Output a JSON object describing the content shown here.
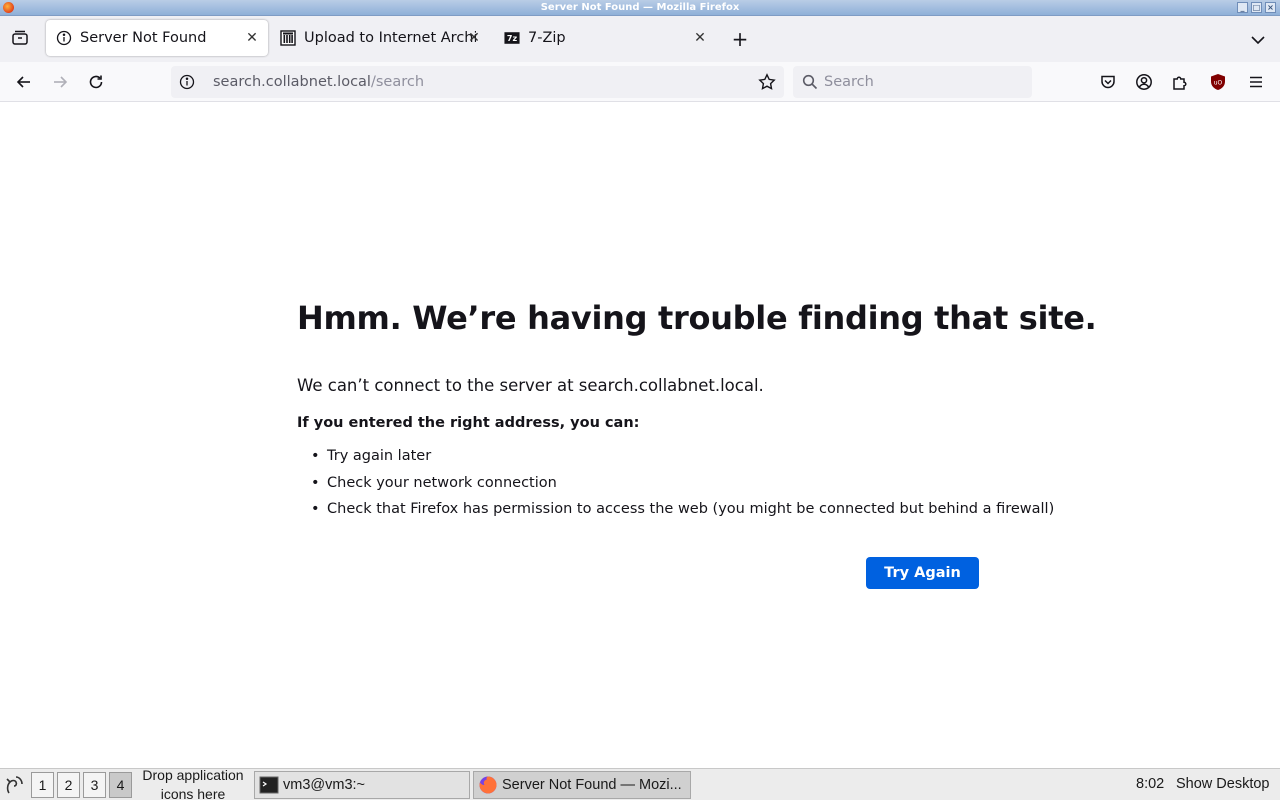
{
  "window": {
    "title": "Server Not Found — Mozilla Firefox",
    "controls": [
      "minimize",
      "maximize",
      "close"
    ]
  },
  "tabs": [
    {
      "label": "Server Not Found",
      "icon": "info-icon",
      "active": true
    },
    {
      "label": "Upload to Internet Archive",
      "icon": "archive-icon",
      "active": false
    },
    {
      "label": "7-Zip",
      "icon": "7zip-icon",
      "active": false
    }
  ],
  "navbar": {
    "url_host": "search.collabnet.local",
    "url_path": "/search",
    "search_placeholder": "Search"
  },
  "error_page": {
    "title": "Hmm. We’re having trouble finding that site.",
    "description": "We can’t connect to the server at search.collabnet.local.",
    "subheading": "If you entered the right address, you can:",
    "suggestions": [
      "Try again later",
      "Check your network connection",
      "Check that Firefox has permission to access the web (you might be connected but behind a firewall)"
    ],
    "button_label": "Try Again",
    "button_color": "#0061e0"
  },
  "taskbar": {
    "workspaces": [
      "1",
      "2",
      "3",
      "4"
    ],
    "active_workspace": "4",
    "drop_hint": "Drop application icons here",
    "tasks": [
      {
        "label": "vm3@vm3:~",
        "icon": "terminal-icon"
      },
      {
        "label": "Server Not Found — Mozi...",
        "icon": "firefox-icon"
      }
    ],
    "clock": "8:02",
    "show_desktop": "Show Desktop"
  }
}
